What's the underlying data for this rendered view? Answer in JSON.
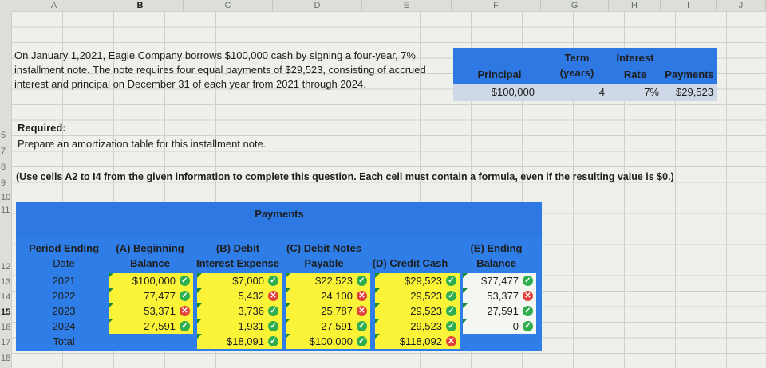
{
  "columns": [
    "A",
    "B",
    "C",
    "D",
    "E",
    "F",
    "G",
    "H",
    "I",
    "J"
  ],
  "rows": [
    "",
    "",
    "",
    "5",
    "7",
    "8",
    "9",
    "10",
    "11",
    "12",
    "13",
    "14",
    "15",
    "16",
    "17",
    "18"
  ],
  "problem_text": "On January 1,2021, Eagle Company borrows $100,000 cash by signing a four-year, 7% installment note. The note requires four equal payments of $29,523, consisting of accrued interest and principal on December 31 of each year from 2021 through 2024.",
  "required_label": "Required:",
  "prepare_text": "Prepare an amortization table for this installment note.",
  "instruction": "(Use cells A2 to I4 from the given information to complete this question. Each cell must contain a formula, even if the resulting value is $0.)",
  "info": {
    "principal_label": "Principal",
    "principal_value": "$100,000",
    "term_label_1": "Term",
    "term_label_2": "(years)",
    "term_value": "4",
    "rate_label_1": "Interest",
    "rate_label_2": "Rate",
    "rate_value": "7%",
    "payments_label": "Payments",
    "payments_value": "$29,523"
  },
  "table": {
    "group_header": "Payments",
    "headers": {
      "period_1": "Period Ending",
      "period_2": "Date",
      "a_1": "(A) Beginning",
      "a_2": "Balance",
      "b_1": "(B) Debit",
      "b_2": "Interest Expense",
      "c_1": "(C) Debit Notes",
      "c_2": "Payable",
      "d_1": "(D) Credit Cash",
      "e_1": "(E) Ending",
      "e_2": "Balance"
    },
    "dates": [
      "2021",
      "2022",
      "2023",
      "2024",
      "Total"
    ],
    "col_a": [
      {
        "v": "$100,000",
        "s": "ok"
      },
      {
        "v": "77,477",
        "s": "ok"
      },
      {
        "v": "53,371",
        "s": "bad"
      },
      {
        "v": "27,591",
        "s": "ok"
      }
    ],
    "col_b": [
      {
        "v": "$7,000",
        "s": "ok"
      },
      {
        "v": "5,432",
        "s": "bad"
      },
      {
        "v": "3,736",
        "s": "ok"
      },
      {
        "v": "1,931",
        "s": "ok"
      },
      {
        "v": "$18,091",
        "s": "ok"
      }
    ],
    "col_c": [
      {
        "v": "$22,523",
        "s": "ok"
      },
      {
        "v": "24,100",
        "s": "bad"
      },
      {
        "v": "25,787",
        "s": "bad"
      },
      {
        "v": "27,591",
        "s": "ok"
      },
      {
        "v": "$100,000",
        "s": "ok"
      }
    ],
    "col_d": [
      {
        "v": "$29,523",
        "s": "ok"
      },
      {
        "v": "29,523",
        "s": "ok"
      },
      {
        "v": "29,523",
        "s": "ok"
      },
      {
        "v": "29,523",
        "s": "ok"
      },
      {
        "v": "$118,092",
        "s": "bad"
      }
    ],
    "col_e": [
      {
        "v": "$77,477",
        "s": "ok"
      },
      {
        "v": "53,377",
        "s": "bad"
      },
      {
        "v": "27,591",
        "s": "ok"
      },
      {
        "v": "0",
        "s": "ok"
      }
    ]
  },
  "colors": {
    "header_blue": "#2e78e3",
    "input_yellow": "#fbf337",
    "ok_green": "#2eae4f",
    "error_red": "#e0413b"
  }
}
